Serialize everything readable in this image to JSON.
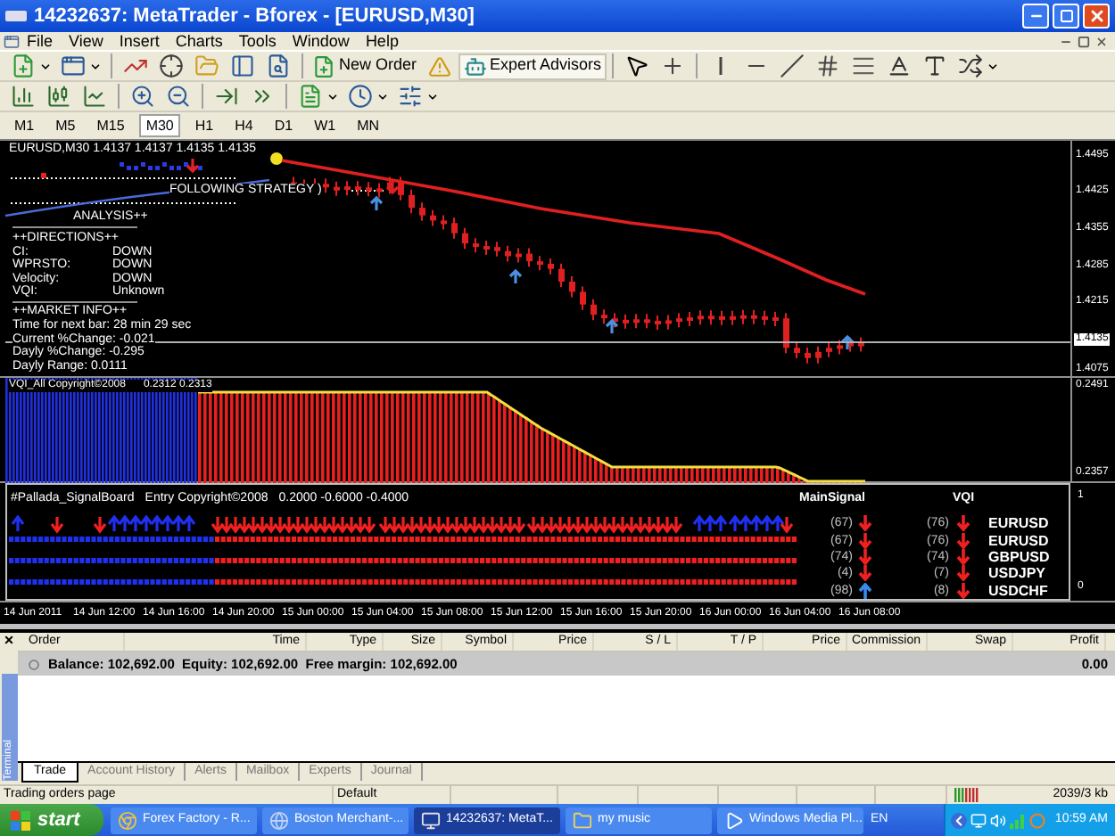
{
  "window": {
    "title": "14232637: MetaTrader - Bforex - [EURUSD,M30]"
  },
  "menu": [
    "File",
    "View",
    "Insert",
    "Charts",
    "Tools",
    "Window",
    "Help"
  ],
  "toolbar": {
    "new_order": "New Order",
    "expert_advisors": "Expert Advisors"
  },
  "timeframes": [
    {
      "label": "M1",
      "selected": false
    },
    {
      "label": "M5",
      "selected": false
    },
    {
      "label": "M15",
      "selected": false
    },
    {
      "label": "M30",
      "selected": true
    },
    {
      "label": "H1",
      "selected": false
    },
    {
      "label": "H4",
      "selected": false
    },
    {
      "label": "D1",
      "selected": false
    },
    {
      "label": "W1",
      "selected": false
    },
    {
      "label": "MN",
      "selected": false
    }
  ],
  "chart": {
    "header": "EURUSD,M30  1.4137 1.4137 1.4135 1.4135",
    "strategy_label": "FOLLOWING STRATEGY )",
    "analysis_label": "ANALYSIS++",
    "directions_title": "++DIRECTIONS++",
    "directions": [
      {
        "name": "CI:",
        "value": "DOWN"
      },
      {
        "name": "WPRSTO:",
        "value": "DOWN"
      },
      {
        "name": "Velocity:",
        "value": "DOWN"
      },
      {
        "name": "VQI:",
        "value": "Unknown"
      }
    ],
    "market_title": "++MARKET INFO++",
    "market_info": [
      "Time for next bar: 28 min 29 sec",
      "Current %Change: -0.021",
      "Dayly %Change: -0.295",
      "Dayly Range: 0.0111"
    ],
    "price_labels": [
      {
        "text": "1.4495",
        "current": false
      },
      {
        "text": "1.4425",
        "current": false
      },
      {
        "text": "1.4355",
        "current": false
      },
      {
        "text": "1.4285",
        "current": false
      },
      {
        "text": "1.4215",
        "current": false
      },
      {
        "text": "1.4135",
        "current": true
      },
      {
        "text": "1.4075",
        "current": false
      }
    ]
  },
  "indicator": {
    "label": "VQI_All Copyright©2008",
    "values": "0.2312 0.2313",
    "scale": [
      "0.2491",
      "0.2357"
    ]
  },
  "signal_board": {
    "title": "#Pallada_SignalBoard",
    "subtitle": "Entry Copyright©2008",
    "params": "0.2000 -0.6000 -0.4000",
    "main_signal_heading": "MainSignal",
    "vqi_heading": "VQI",
    "rows": [
      {
        "main_value": "(67)",
        "main_up": false,
        "vqi_value": "(76)",
        "vqi_up": false,
        "symbol": "EURUSD"
      },
      {
        "main_value": "(67)",
        "main_up": false,
        "vqi_value": "(76)",
        "vqi_up": false,
        "symbol": "EURUSD"
      },
      {
        "main_value": "(74)",
        "main_up": false,
        "vqi_value": "(74)",
        "vqi_up": false,
        "symbol": "GBPUSD"
      },
      {
        "main_value": "(4)",
        "main_up": false,
        "vqi_value": "(7)",
        "vqi_up": false,
        "symbol": "USDJPY"
      },
      {
        "main_value": "(98)",
        "main_up": true,
        "vqi_value": "(8)",
        "vqi_up": false,
        "symbol": "USDCHF"
      }
    ],
    "scale": [
      "1",
      "0"
    ]
  },
  "time_axis": [
    "14 Jun 2011",
    "14 Jun 12:00",
    "14 Jun 16:00",
    "14 Jun 20:00",
    "15 Jun 00:00",
    "15 Jun 04:00",
    "15 Jun 08:00",
    "15 Jun 12:00",
    "15 Jun 16:00",
    "15 Jun 20:00",
    "16 Jun 00:00",
    "16 Jun 04:00",
    "16 Jun 08:00"
  ],
  "terminal": {
    "close": "×",
    "label": "Terminal",
    "columns": [
      "Order",
      "Time",
      "Type",
      "Size",
      "Symbol",
      "Price",
      "S / L",
      "T / P",
      "Price",
      "Commission",
      "Swap",
      "Profit"
    ],
    "balance": "Balance: 102,692.00  Equity: 102,692.00  Free margin: 102,692.00",
    "profit": "0.00",
    "tabs": [
      {
        "label": "Trade",
        "selected": true
      },
      {
        "label": "Account History",
        "selected": false
      },
      {
        "label": "Alerts",
        "selected": false
      },
      {
        "label": "Mailbox",
        "selected": false
      },
      {
        "label": "Experts",
        "selected": false
      },
      {
        "label": "Journal",
        "selected": false
      }
    ]
  },
  "status_bar": {
    "hint": "Trading orders page",
    "profile": "Default",
    "traffic": "2039/3 kb"
  },
  "taskbar": {
    "start": "start",
    "items": [
      {
        "label": "Forex Factory - R...",
        "kind": "browser",
        "selected": false
      },
      {
        "label": "Boston Merchant-...",
        "kind": "globe",
        "selected": false
      },
      {
        "label": "14232637: MetaT...",
        "kind": "app",
        "selected": true
      },
      {
        "label": "my music",
        "kind": "folder",
        "selected": false
      },
      {
        "label": "Windows Media Pl...",
        "kind": "media",
        "selected": false
      }
    ],
    "language": "EN",
    "clock": "10:59 AM"
  }
}
